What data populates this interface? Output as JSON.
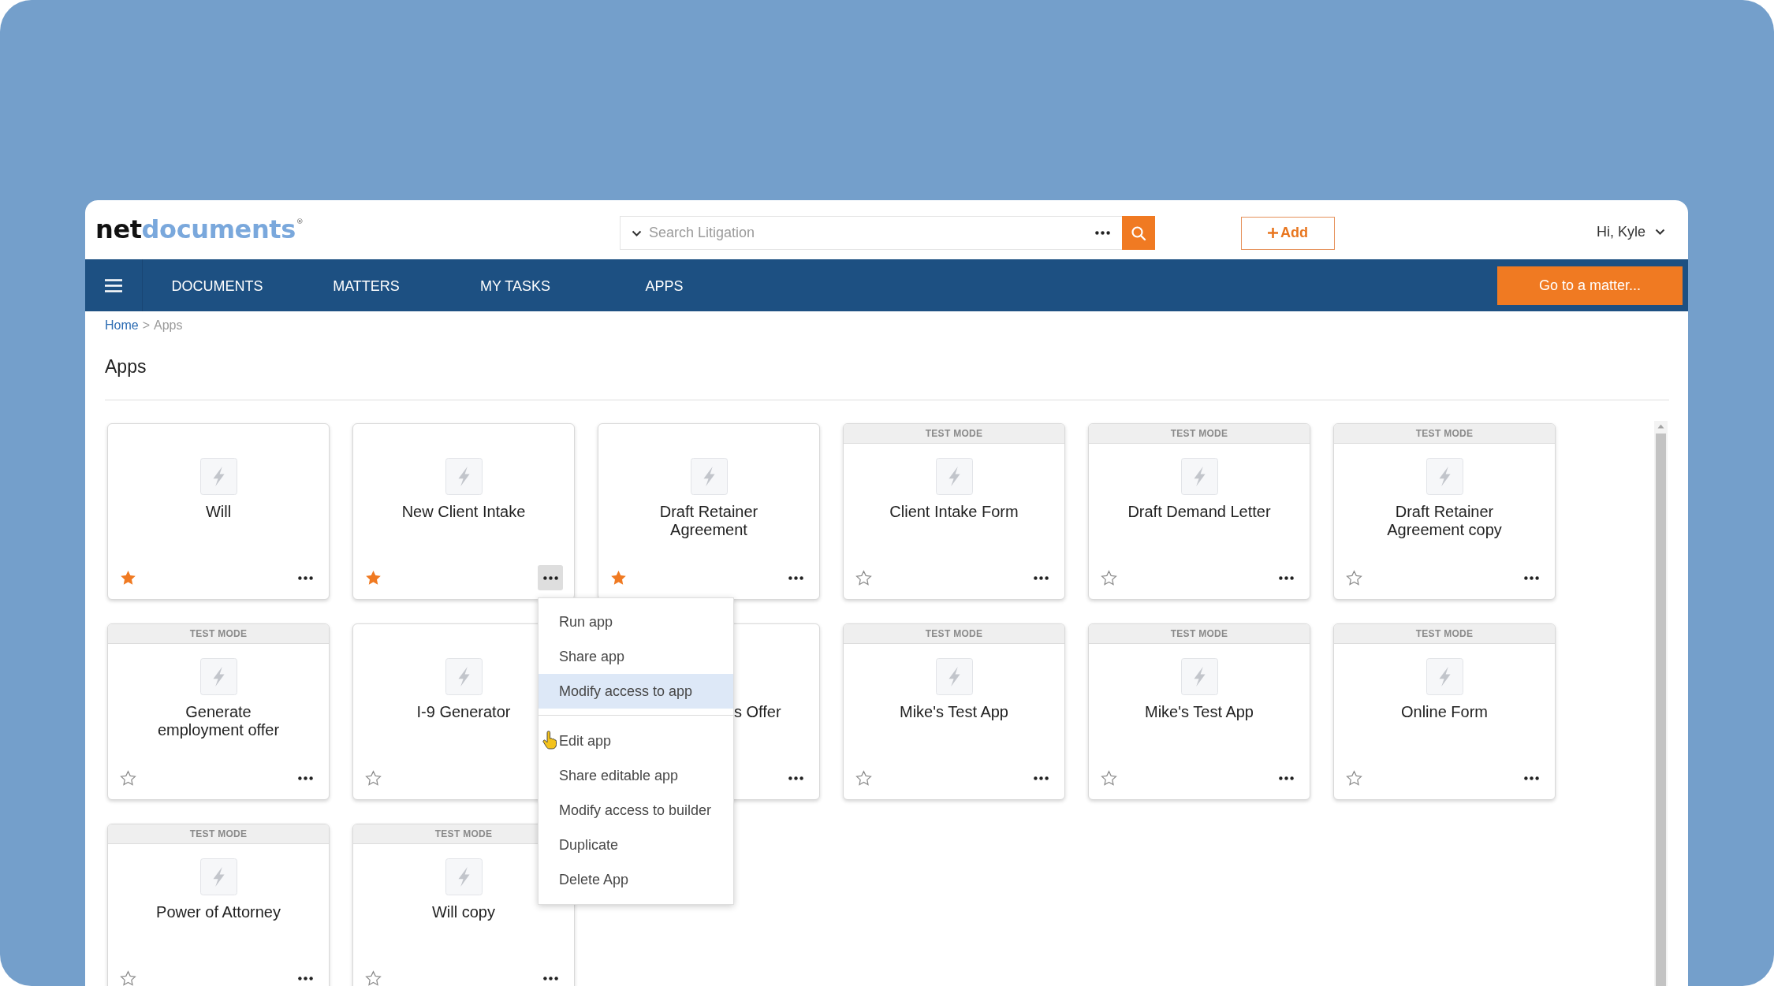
{
  "header": {
    "logo": [
      "net",
      "documents"
    ],
    "logo_mark": "®",
    "search": {
      "placeholder": "Search Litigation"
    },
    "add_button": {
      "label": "Add"
    },
    "greeting": "Hi, Kyle"
  },
  "nav": {
    "items": [
      "DOCUMENTS",
      "MATTERS",
      "MY TASKS",
      "APPS"
    ],
    "action_button": "Go to a matter..."
  },
  "breadcrumb": {
    "items": [
      {
        "label": "Home",
        "link": true
      },
      {
        "label": "Apps",
        "link": false
      }
    ],
    "separator": ">"
  },
  "page_title": "Apps",
  "apps": [
    {
      "title": "Will",
      "starred": true,
      "menu_open": false,
      "under_menu": false
    },
    {
      "title": "New Client Intake",
      "starred": true,
      "menu_open": true,
      "under_menu": false
    },
    {
      "title": "Draft Retainer Agreement",
      "starred": true,
      "menu_open": false,
      "under_menu": false
    },
    {
      "title": "Client Intake Form",
      "banner": "TEST MODE",
      "starred": false,
      "menu_open": false,
      "under_menu": false
    },
    {
      "title": "Draft Demand Letter",
      "banner": "TEST MODE",
      "starred": false,
      "menu_open": false,
      "under_menu": false
    },
    {
      "title": "Draft Retainer Agreement copy",
      "banner": "TEST MODE",
      "starred": false,
      "menu_open": false,
      "under_menu": false
    },
    {
      "title": "Generate employment offer",
      "banner": "TEST MODE",
      "starred": false,
      "menu_open": false,
      "under_menu": false
    },
    {
      "title": "I-9 Generator",
      "starred": false,
      "under_menu": false
    },
    {
      "title": "s Offer",
      "menu_open": false,
      "under_menu": true
    },
    {
      "title": "Mike's Test App",
      "banner": "TEST MODE",
      "starred": false,
      "menu_open": false,
      "under_menu": false
    },
    {
      "title": "Mike's Test App",
      "banner": "TEST MODE",
      "starred": false,
      "menu_open": false,
      "under_menu": false
    },
    {
      "title": "Online Form",
      "banner": "TEST MODE",
      "starred": false,
      "menu_open": false,
      "under_menu": false
    },
    {
      "title": "Power of Attorney",
      "banner": "TEST MODE",
      "starred": false,
      "menu_open": false,
      "under_menu": false
    },
    {
      "title": "Will copy",
      "banner": "TEST MODE",
      "starred": false,
      "menu_open": false,
      "under_menu": false
    }
  ],
  "context_menu": {
    "groups": [
      [
        {
          "label": "Run app",
          "selected": false,
          "pointer": false
        },
        {
          "label": "Share app",
          "selected": false,
          "pointer": false
        },
        {
          "label": "Modify access to app",
          "selected": true,
          "pointer": false
        }
      ],
      [
        {
          "label": "Edit app",
          "selected": false,
          "pointer": true
        },
        {
          "label": "Share editable app",
          "selected": false,
          "pointer": false
        },
        {
          "label": "Modify access to builder",
          "selected": false,
          "pointer": false
        },
        {
          "label": "Duplicate",
          "selected": false,
          "pointer": false
        },
        {
          "label": "Delete App",
          "selected": false,
          "pointer": false
        }
      ]
    ]
  }
}
